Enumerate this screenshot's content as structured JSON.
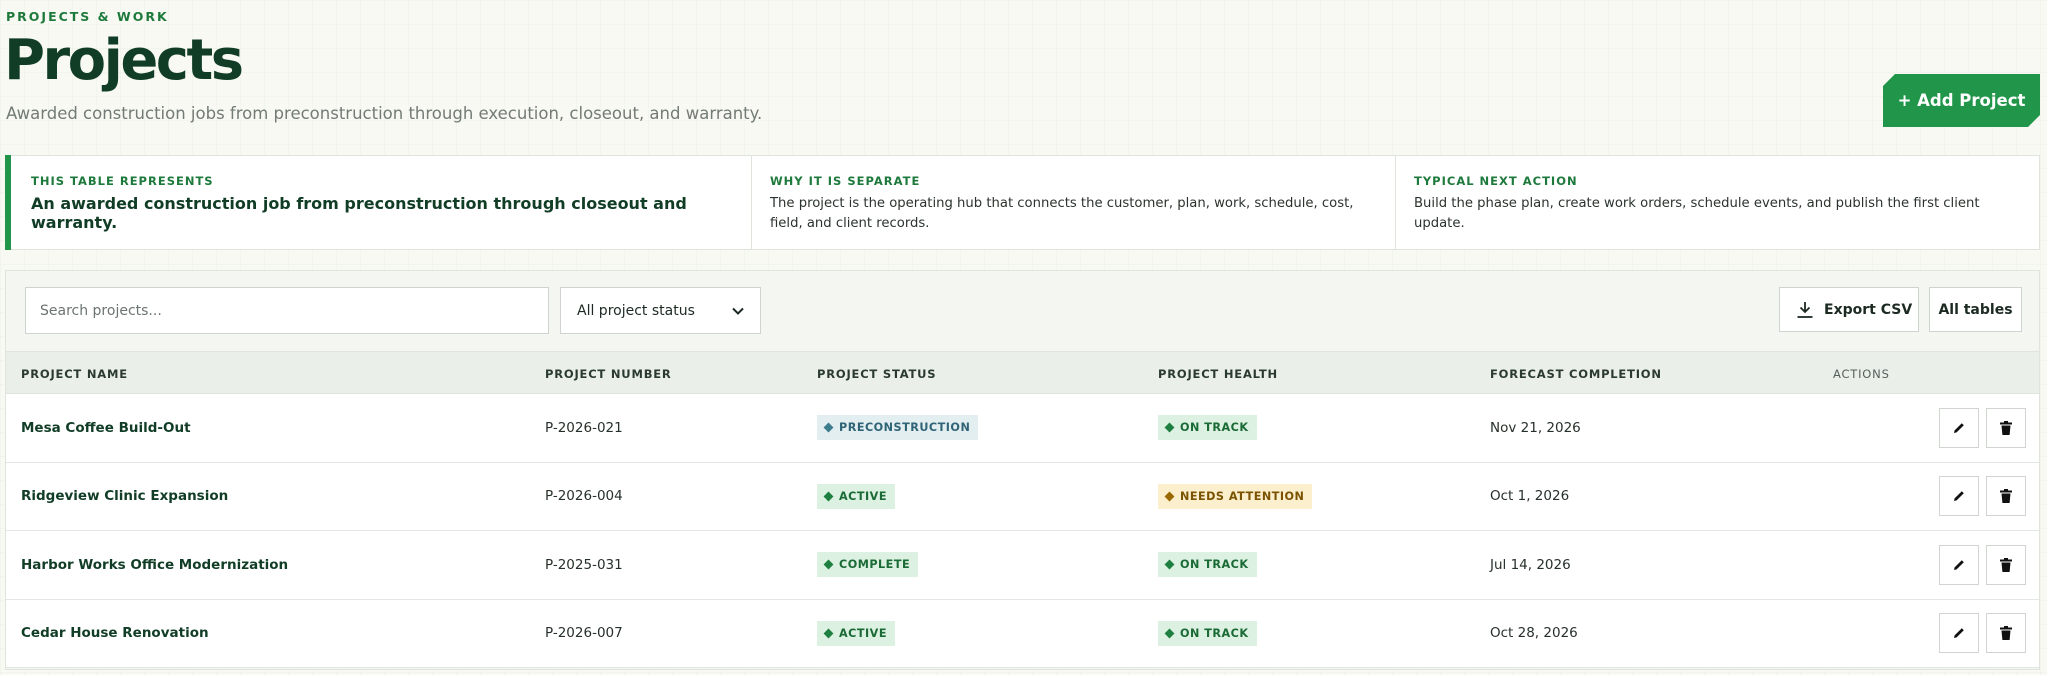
{
  "header": {
    "eyebrow": "PROJECTS & WORK",
    "title": "Projects",
    "subtitle": "Awarded construction jobs from preconstruction through execution, closeout, and warranty.",
    "add_button": "+ Add Project"
  },
  "info": {
    "represents_label": "THIS TABLE REPRESENTS",
    "represents_text": "An awarded construction job from preconstruction through closeout and warranty.",
    "separate_label": "WHY IT IS SEPARATE",
    "separate_text": "The project is the operating hub that connects the customer, plan, work, schedule, cost, field, and client records.",
    "next_label": "TYPICAL NEXT ACTION",
    "next_text": "Build the phase plan, create work orders, schedule events, and publish the first client update."
  },
  "toolbar": {
    "search_placeholder": "Search projects...",
    "status_filter": "All project status",
    "export_label": "Export CSV",
    "all_tables_label": "All tables"
  },
  "columns": {
    "name": "PROJECT NAME",
    "number": "PROJECT NUMBER",
    "status": "PROJECT STATUS",
    "health": "PROJECT HEALTH",
    "forecast": "FORECAST COMPLETION",
    "actions": "ACTIONS"
  },
  "rows": [
    {
      "name": "Mesa Coffee Build-Out",
      "number": "P-2026-021",
      "status": "PRECONSTRUCTION",
      "health": "ON TRACK",
      "forecast": "Nov 21, 2026"
    },
    {
      "name": "Ridgeview Clinic Expansion",
      "number": "P-2026-004",
      "status": "ACTIVE",
      "health": "NEEDS ATTENTION",
      "forecast": "Oct 1, 2026"
    },
    {
      "name": "Harbor Works Office Modernization",
      "number": "P-2025-031",
      "status": "COMPLETE",
      "health": "ON TRACK",
      "forecast": "Jul 14, 2026"
    },
    {
      "name": "Cedar House Renovation",
      "number": "P-2026-007",
      "status": "ACTIVE",
      "health": "ON TRACK",
      "forecast": "Oct 28, 2026"
    }
  ],
  "colors": {
    "brand_green": "#21964b",
    "title_green": "#113d26",
    "preconstruction_badge": "#e3eef1",
    "green_badge": "#dcf1e1",
    "warning_badge": "#fbefcd"
  },
  "icons": {
    "export": "download-icon",
    "select": "chevron-down-icon",
    "edit": "pencil-icon",
    "delete": "trash-icon",
    "badge": "diamond-icon"
  }
}
